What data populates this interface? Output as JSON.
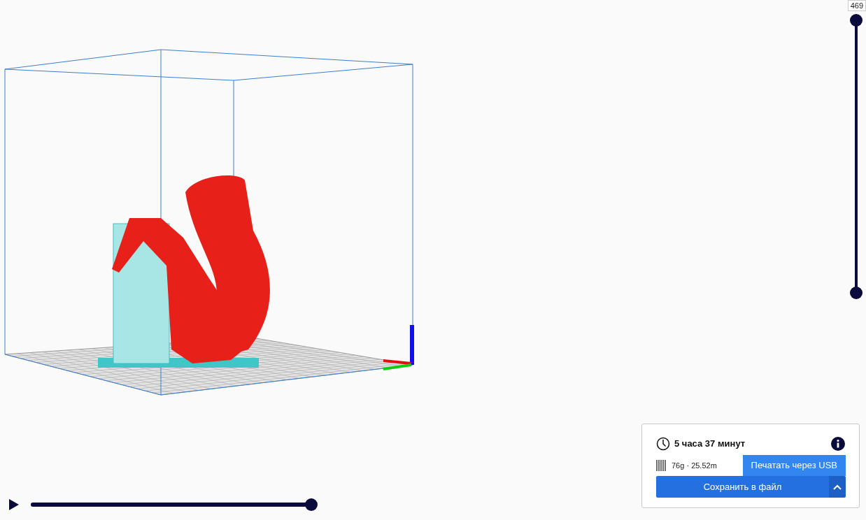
{
  "layer_slider": {
    "value": "469",
    "handles": [
      {
        "level": 1
      },
      {
        "level": 0
      }
    ]
  },
  "playback": {
    "level": 1
  },
  "print_info": {
    "time": "5 часа 37 минут",
    "material": "76g · 25.52m",
    "usb_button": "Печатать через USB",
    "save_button": "Сохранить в файл"
  }
}
